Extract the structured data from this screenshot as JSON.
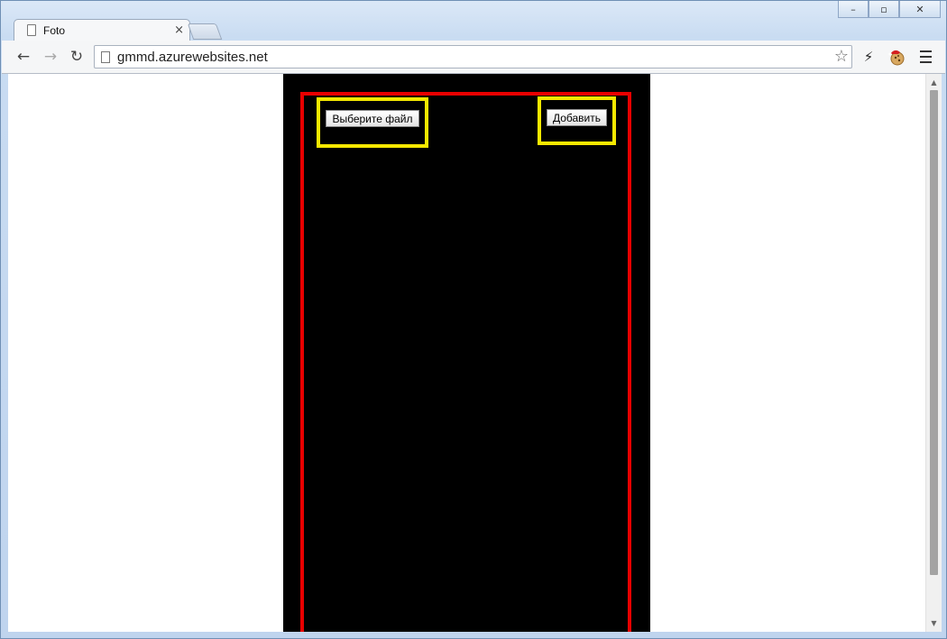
{
  "window": {
    "minimize_label": "–",
    "maximize_label": "▫",
    "close_label": "✕"
  },
  "tabs": [
    {
      "title": "Foto",
      "close_label": "×"
    }
  ],
  "toolbar": {
    "back_label": "←",
    "forward_label": "→",
    "reload_label": "↻",
    "url": "gmmd.azurewebsites.net",
    "star_label": "☆",
    "ext_bolt_label": "⚡"
  },
  "page": {
    "choose_file_button": "Выберите файл",
    "add_button": "Добавить",
    "colors": {
      "background": "#000000",
      "frame": "#e80000",
      "highlight": "#f5e800"
    }
  },
  "scrollbar": {
    "up_label": "▲",
    "down_label": "▼"
  }
}
